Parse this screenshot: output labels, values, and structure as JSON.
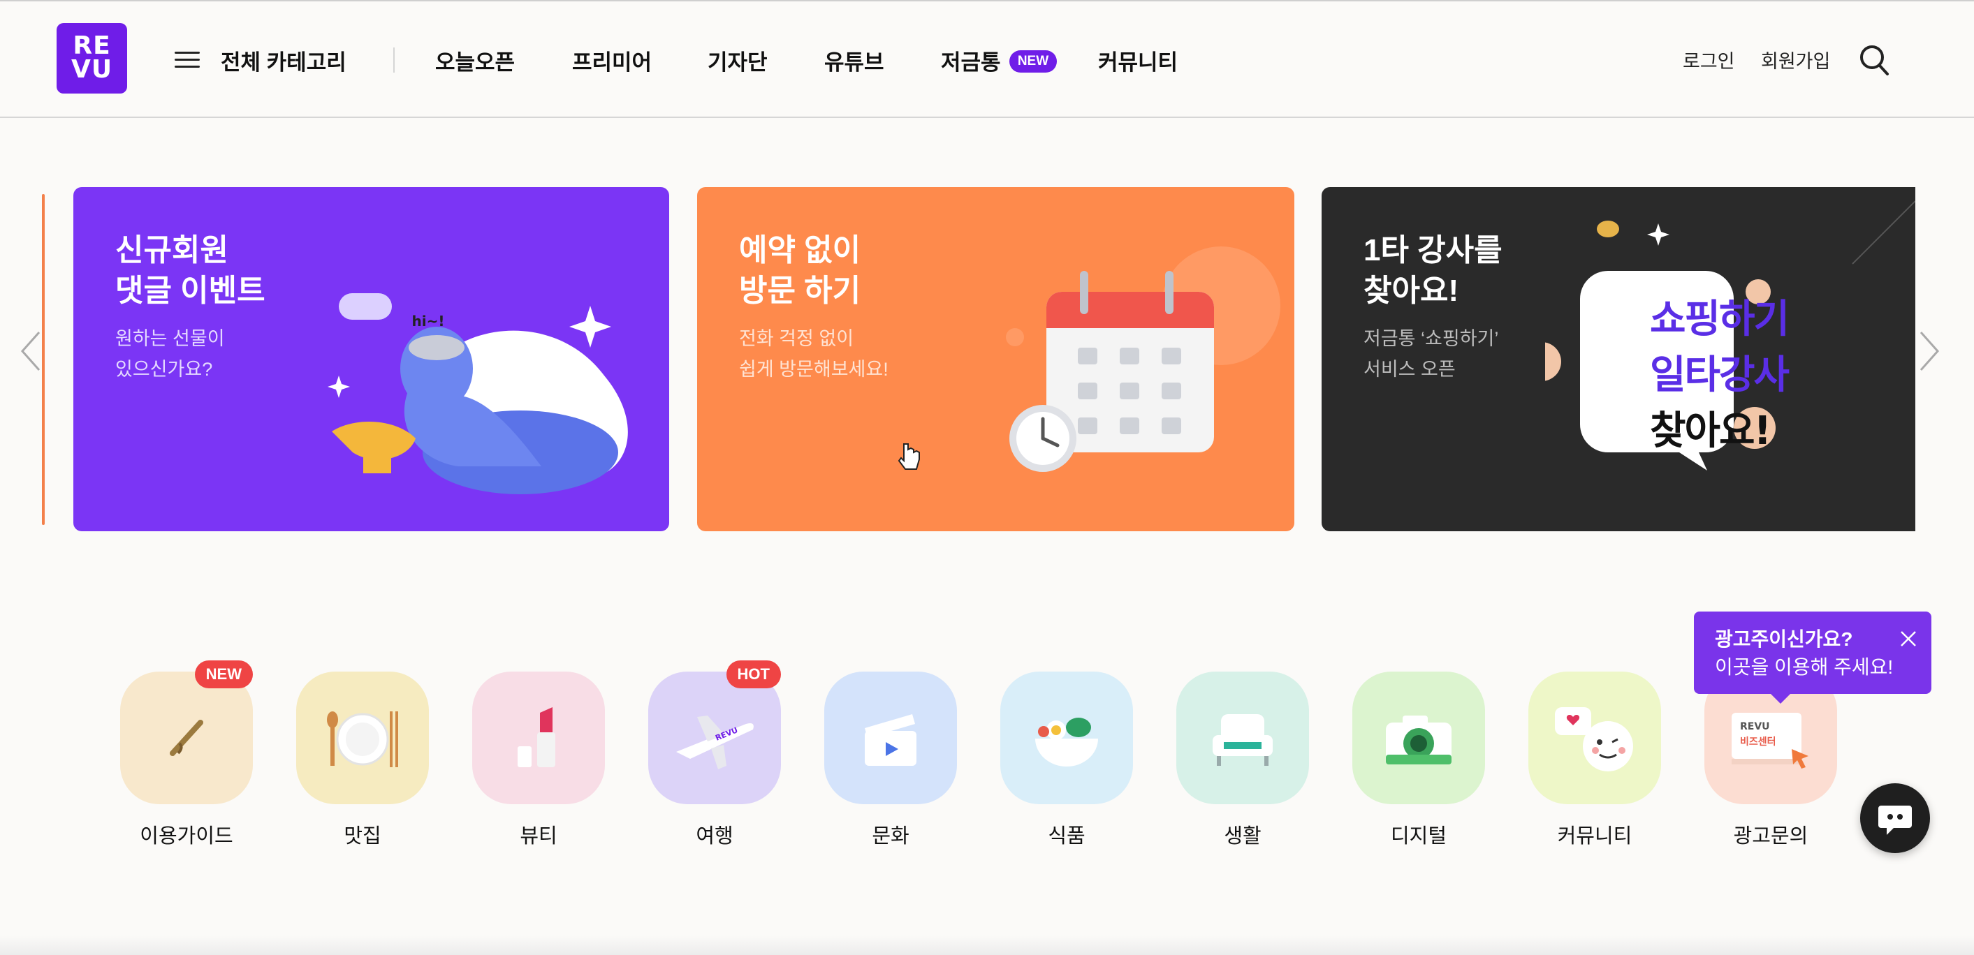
{
  "brand": {
    "logo_line1": "RE",
    "logo_line2": "VU",
    "accent": "#6f1de8"
  },
  "header": {
    "category_label": "전체 카테고리",
    "nav": [
      "오늘오픈",
      "프리미어",
      "기자단",
      "유튜브",
      "저금통",
      "커뮤니티"
    ],
    "new_badge": "NEW",
    "login": "로그인",
    "signup": "회원가입"
  },
  "banners": [
    {
      "title": "신규회원\n댓글 이벤트",
      "subtitle": "원하는 선물이\n있으신가요?",
      "bg": "#7b35f5",
      "speech": "hi~!"
    },
    {
      "title": "예약 없이\n방문 하기",
      "subtitle": "전화 걱정 없이\n쉽게 방문해보세요!",
      "bg": "#fe8a4c"
    },
    {
      "title": "1타 강사를\n찾아요!",
      "subtitle": "저금통 ‘쇼핑하기’\n서비스 오픈",
      "bg": "#2a2a2a",
      "poster": [
        "쇼핑하기",
        "일타강사",
        "찾아요!"
      ]
    }
  ],
  "categories": [
    {
      "label": "이용가이드",
      "badge": "NEW",
      "bg": "#f8e8cc",
      "icon": "pencil-icon"
    },
    {
      "label": "맛집",
      "bg": "#f6ebc0",
      "icon": "plate-icon"
    },
    {
      "label": "뷰티",
      "bg": "#f8dde6",
      "icon": "lipstick-icon"
    },
    {
      "label": "여행",
      "badge": "HOT",
      "bg": "#dcd3f8",
      "icon": "airplane-icon",
      "plane_text": "REVU"
    },
    {
      "label": "문화",
      "bg": "#d4e3fb",
      "icon": "clapperboard-icon"
    },
    {
      "label": "식품",
      "bg": "#d9eef9",
      "icon": "food-bowl-icon"
    },
    {
      "label": "생활",
      "bg": "#d7f1e8",
      "icon": "armchair-icon"
    },
    {
      "label": "디지털",
      "bg": "#dcf4cf",
      "icon": "camera-icon"
    },
    {
      "label": "커뮤니티",
      "bg": "#eef7c8",
      "icon": "chat-bubbles-icon"
    },
    {
      "label": "광고문의",
      "bg": "#fcddd2",
      "icon": "biz-board-icon",
      "board_line1": "REVU",
      "board_line2": "비즈센터"
    }
  ],
  "tooltip": {
    "title": "광고주이신가요?",
    "body": "이곳을 이용해 주세요!"
  }
}
